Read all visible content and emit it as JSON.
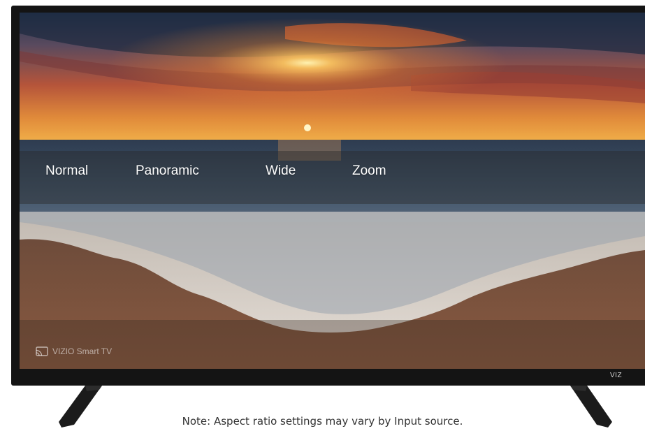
{
  "aspect_menu": {
    "options": [
      "Normal",
      "Panoramic",
      "Wide",
      "Zoom"
    ]
  },
  "screen_badge": {
    "icon": "cast-icon",
    "label": "VIZIO Smart TV"
  },
  "tv": {
    "brand": "VIZ"
  },
  "footer": {
    "note": "Note: Aspect ratio settings may vary by Input source."
  },
  "colors": {
    "bezel": "#141414",
    "menu_text": "#ffffff",
    "note_text": "#333333"
  }
}
